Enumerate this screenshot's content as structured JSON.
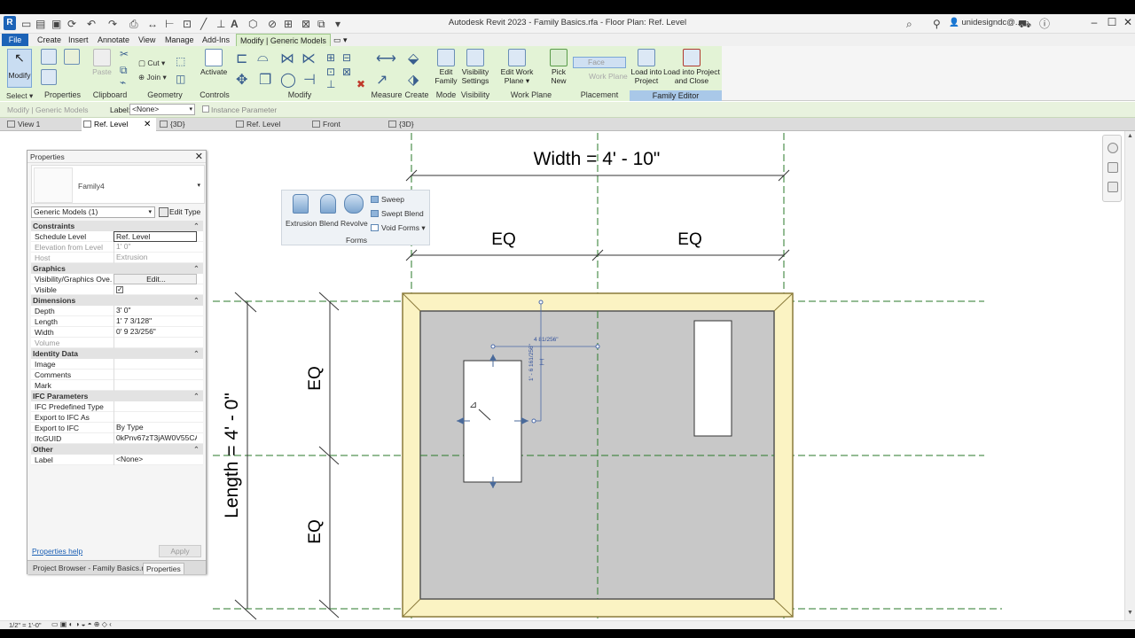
{
  "app": {
    "title": "Autodesk Revit 2023 - Family Basics.rfa - Floor Plan: Ref. Level",
    "user": "unidesigndc@...",
    "logo": "R"
  },
  "ribbon_tabs": [
    "File",
    "Create",
    "Insert",
    "Annotate",
    "View",
    "Manage",
    "Add-Ins",
    "Modify | Generic Models"
  ],
  "ribbon": {
    "modify_label": "Modify",
    "select_label": "Select",
    "properties_label": "Properties",
    "paste_label": "Paste",
    "cut_label": "Cut",
    "join_label": "Join",
    "clipboard_label": "Clipboard",
    "geometry_label": "Geometry",
    "activate_label": "Activate",
    "controls_label": "Controls",
    "modify_panel_label": "Modify",
    "measure_label": "Measure",
    "create_label": "Create",
    "edit_family_label": "Edit Family",
    "mode_label": "Mode",
    "visibility_settings_label": "Visibility Settings",
    "visibility_label": "Visibility",
    "edit_work_plane_label": "Edit Work Plane",
    "work_plane_label": "Work Plane",
    "pick_new_label": "Pick New",
    "face_label": "Face",
    "work_plane_option_label": "Work Plane",
    "placement_label": "Placement",
    "load_into_project_label": "Load into Project",
    "load_into_project_close_label": "Load into Project and Close",
    "family_editor_label": "Family Editor"
  },
  "options_bar": {
    "context": "Modify | Generic Models",
    "label_caption": "Label:",
    "label_value": "<None>",
    "instance_parameter": "Instance Parameter"
  },
  "view_tabs": [
    {
      "label": "View 1",
      "active": false
    },
    {
      "label": "Ref. Level",
      "active": true
    },
    {
      "label": "{3D}",
      "active": false
    },
    {
      "label": "Ref. Level",
      "active": false
    },
    {
      "label": "Front",
      "active": false
    },
    {
      "label": "{3D}",
      "active": false
    }
  ],
  "forms_popup": {
    "extrusion": "Extrusion",
    "blend": "Blend",
    "revolve": "Revolve",
    "sweep": "Sweep",
    "swept_blend": "Swept Blend",
    "void_forms": "Void Forms",
    "panel_label": "Forms"
  },
  "properties": {
    "title": "Properties",
    "type_name": "Family4",
    "instance_selector": "Generic Models (1)",
    "edit_type": "Edit Type",
    "groups": [
      {
        "name": "Constraints",
        "rows": [
          {
            "k": "Schedule Level",
            "v": "Ref. Level",
            "style": "boxed"
          },
          {
            "k": "Elevation from Level",
            "v": "1'  0\"",
            "style": "disabled"
          },
          {
            "k": "Host",
            "v": "Extrusion",
            "style": "disabled"
          }
        ]
      },
      {
        "name": "Graphics",
        "rows": [
          {
            "k": "Visibility/Graphics Ove...",
            "v": "Edit...",
            "style": "button"
          },
          {
            "k": "Visible",
            "v": "",
            "style": "check"
          }
        ]
      },
      {
        "name": "Dimensions",
        "rows": [
          {
            "k": "Depth",
            "v": "3'  0\"",
            "style": ""
          },
          {
            "k": "Length",
            "v": "1'  7 3/128\"",
            "style": ""
          },
          {
            "k": "Width",
            "v": "0'  9 23/256\"",
            "style": ""
          },
          {
            "k": "Volume",
            "v": "",
            "style": "disabled"
          }
        ]
      },
      {
        "name": "Identity Data",
        "rows": [
          {
            "k": "Image",
            "v": "",
            "style": ""
          },
          {
            "k": "Comments",
            "v": "",
            "style": ""
          },
          {
            "k": "Mark",
            "v": "",
            "style": ""
          }
        ]
      },
      {
        "name": "IFC Parameters",
        "rows": [
          {
            "k": "IFC Predefined Type",
            "v": "",
            "style": ""
          },
          {
            "k": "Export to IFC As",
            "v": "",
            "style": ""
          },
          {
            "k": "Export to IFC",
            "v": "By Type",
            "style": ""
          },
          {
            "k": "IfcGUID",
            "v": "0kPnv67zT3jAW0V55CA...",
            "style": ""
          }
        ]
      },
      {
        "name": "Other",
        "rows": [
          {
            "k": "Label",
            "v": "<None>",
            "style": ""
          }
        ]
      }
    ],
    "help_link": "Properties help",
    "apply": "Apply",
    "bottom_tabs": [
      "Project Browser - Family Basics.rfa",
      "Properties"
    ]
  },
  "drawing": {
    "width_dim": "Width = 4' - 10\"",
    "length_dim": "Length = 4' - 0\"",
    "eq_label": "EQ",
    "temp_dim_horizontal": "4 81/256\"",
    "temp_dim_vertical": "1' - 6 161/256\""
  },
  "status": {
    "scale": "1/2\" = 1'-0\""
  }
}
